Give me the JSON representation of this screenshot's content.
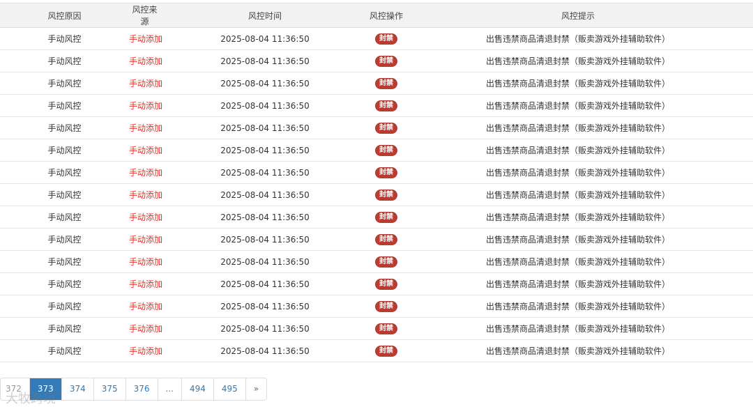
{
  "table": {
    "headers": [
      "风控原因",
      "风控来源",
      "风控时间",
      "风控操作",
      "风控提示"
    ],
    "rows": [
      {
        "reason": "手动风控",
        "source": "手动添加",
        "time": "2025-08-04 11:36:50",
        "action": "封禁",
        "hint": "出售违禁商品清退封禁（贩卖游戏外挂辅助软件）"
      },
      {
        "reason": "手动风控",
        "source": "手动添加",
        "time": "2025-08-04 11:36:50",
        "action": "封禁",
        "hint": "出售违禁商品清退封禁（贩卖游戏外挂辅助软件）"
      },
      {
        "reason": "手动风控",
        "source": "手动添加",
        "time": "2025-08-04 11:36:50",
        "action": "封禁",
        "hint": "出售违禁商品清退封禁（贩卖游戏外挂辅助软件）"
      },
      {
        "reason": "手动风控",
        "source": "手动添加",
        "time": "2025-08-04 11:36:50",
        "action": "封禁",
        "hint": "出售违禁商品清退封禁（贩卖游戏外挂辅助软件）"
      },
      {
        "reason": "手动风控",
        "source": "手动添加",
        "time": "2025-08-04 11:36:50",
        "action": "封禁",
        "hint": "出售违禁商品清退封禁（贩卖游戏外挂辅助软件）"
      },
      {
        "reason": "手动风控",
        "source": "手动添加",
        "time": "2025-08-04 11:36:50",
        "action": "封禁",
        "hint": "出售违禁商品清退封禁（贩卖游戏外挂辅助软件）"
      },
      {
        "reason": "手动风控",
        "source": "手动添加",
        "time": "2025-08-04 11:36:50",
        "action": "封禁",
        "hint": "出售违禁商品清退封禁（贩卖游戏外挂辅助软件）"
      },
      {
        "reason": "手动风控",
        "source": "手动添加",
        "time": "2025-08-04 11:36:50",
        "action": "封禁",
        "hint": "出售违禁商品清退封禁（贩卖游戏外挂辅助软件）"
      },
      {
        "reason": "手动风控",
        "source": "手动添加",
        "time": "2025-08-04 11:36:50",
        "action": "封禁",
        "hint": "出售违禁商品清退封禁（贩卖游戏外挂辅助软件）"
      },
      {
        "reason": "手动风控",
        "source": "手动添加",
        "time": "2025-08-04 11:36:50",
        "action": "封禁",
        "hint": "出售违禁商品清退封禁（贩卖游戏外挂辅助软件）"
      },
      {
        "reason": "手动风控",
        "source": "手动添加",
        "time": "2025-08-04 11:36:50",
        "action": "封禁",
        "hint": "出售违禁商品清退封禁（贩卖游戏外挂辅助软件）"
      },
      {
        "reason": "手动风控",
        "source": "手动添加",
        "time": "2025-08-04 11:36:50",
        "action": "封禁",
        "hint": "出售违禁商品清退封禁（贩卖游戏外挂辅助软件）"
      },
      {
        "reason": "手动风控",
        "source": "手动添加",
        "time": "2025-08-04 11:36:50",
        "action": "封禁",
        "hint": "出售违禁商品清退封禁（贩卖游戏外挂辅助软件）"
      },
      {
        "reason": "手动风控",
        "source": "手动添加",
        "time": "2025-08-04 11:36:50",
        "action": "封禁",
        "hint": "出售违禁商品清退封禁（贩卖游戏外挂辅助软件）"
      },
      {
        "reason": "手动风控",
        "source": "手动添加",
        "time": "2025-08-04 11:36:50",
        "action": "封禁",
        "hint": "出售违禁商品清退封禁（贩卖游戏外挂辅助软件）"
      }
    ]
  },
  "pagination": {
    "pages": [
      "372",
      "373",
      "374",
      "375",
      "376",
      "...",
      "494",
      "495",
      "»"
    ],
    "active": "373"
  },
  "watermark": "大牧跨境",
  "colors": {
    "source_text": "#e0302a",
    "badge_bg": "#b83c32",
    "active_page_bg": "#337ab7",
    "header_bg": "#f2f2f2"
  }
}
